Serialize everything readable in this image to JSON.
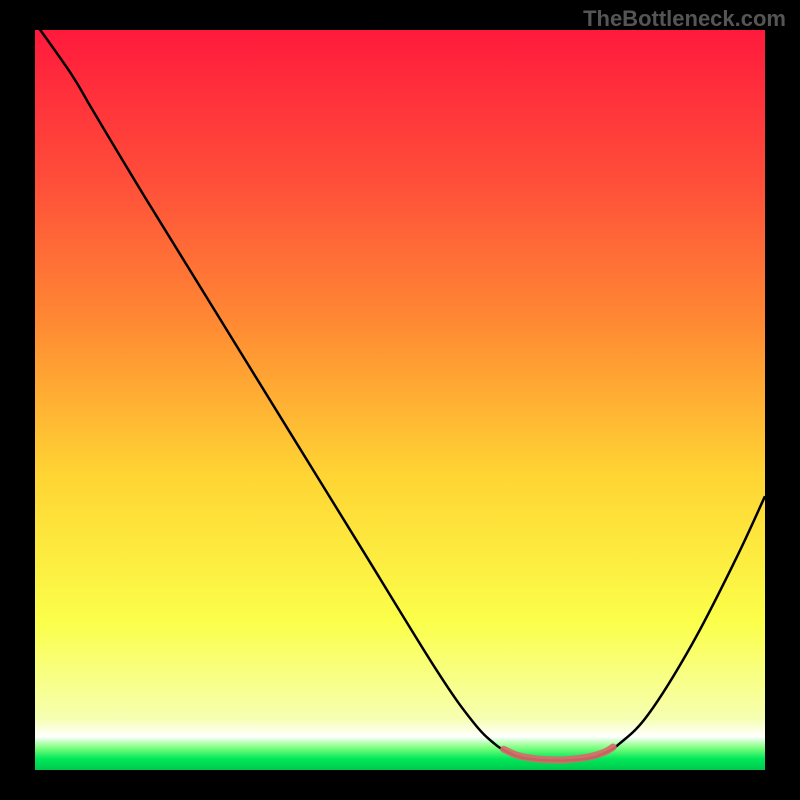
{
  "watermark": "TheBottleneck.com",
  "chart_data": {
    "type": "line",
    "title": "",
    "xlabel": "",
    "ylabel": "",
    "xlim": [
      0,
      100
    ],
    "ylim": [
      0,
      100
    ],
    "background_gradient": {
      "stops": [
        {
          "offset": 0.0,
          "color": "#ff1a3c"
        },
        {
          "offset": 0.2,
          "color": "#ff4d3a"
        },
        {
          "offset": 0.4,
          "color": "#ff8b33"
        },
        {
          "offset": 0.6,
          "color": "#ffd433"
        },
        {
          "offset": 0.8,
          "color": "#fbff4a"
        },
        {
          "offset": 0.93,
          "color": "#f6ffb0"
        },
        {
          "offset": 0.955,
          "color": "#ffffff"
        },
        {
          "offset": 0.97,
          "color": "#7dff7d"
        },
        {
          "offset": 0.985,
          "color": "#00e85a"
        },
        {
          "offset": 1.0,
          "color": "#00c94d"
        }
      ]
    },
    "series": [
      {
        "name": "bottleneck-curve",
        "color": "#000000",
        "width": 2.5,
        "points": [
          {
            "x": 0.0,
            "y": 101.0
          },
          {
            "x": 5.0,
            "y": 94.0
          },
          {
            "x": 8.0,
            "y": 89.0
          },
          {
            "x": 15.0,
            "y": 77.5
          },
          {
            "x": 25.0,
            "y": 61.5
          },
          {
            "x": 35.0,
            "y": 45.5
          },
          {
            "x": 45.0,
            "y": 29.5
          },
          {
            "x": 55.0,
            "y": 13.5
          },
          {
            "x": 60.0,
            "y": 6.5
          },
          {
            "x": 63.0,
            "y": 3.5
          },
          {
            "x": 65.0,
            "y": 2.3
          },
          {
            "x": 67.0,
            "y": 1.6
          },
          {
            "x": 70.0,
            "y": 1.3
          },
          {
            "x": 73.0,
            "y": 1.3
          },
          {
            "x": 76.0,
            "y": 1.6
          },
          {
            "x": 78.0,
            "y": 2.3
          },
          {
            "x": 80.0,
            "y": 3.5
          },
          {
            "x": 84.0,
            "y": 7.5
          },
          {
            "x": 90.0,
            "y": 17.0
          },
          {
            "x": 96.0,
            "y": 28.5
          },
          {
            "x": 100.0,
            "y": 37.0
          }
        ]
      },
      {
        "name": "flat-zone-marker",
        "color": "#d96a6a",
        "width": 7,
        "cap": "round",
        "opacity": 0.92,
        "points": [
          {
            "x": 64.2,
            "y": 2.8
          },
          {
            "x": 66.0,
            "y": 2.0
          },
          {
            "x": 68.0,
            "y": 1.6
          },
          {
            "x": 70.0,
            "y": 1.4
          },
          {
            "x": 72.0,
            "y": 1.35
          },
          {
            "x": 74.0,
            "y": 1.5
          },
          {
            "x": 76.0,
            "y": 1.8
          },
          {
            "x": 78.0,
            "y": 2.4
          },
          {
            "x": 79.2,
            "y": 3.1
          }
        ]
      }
    ]
  }
}
